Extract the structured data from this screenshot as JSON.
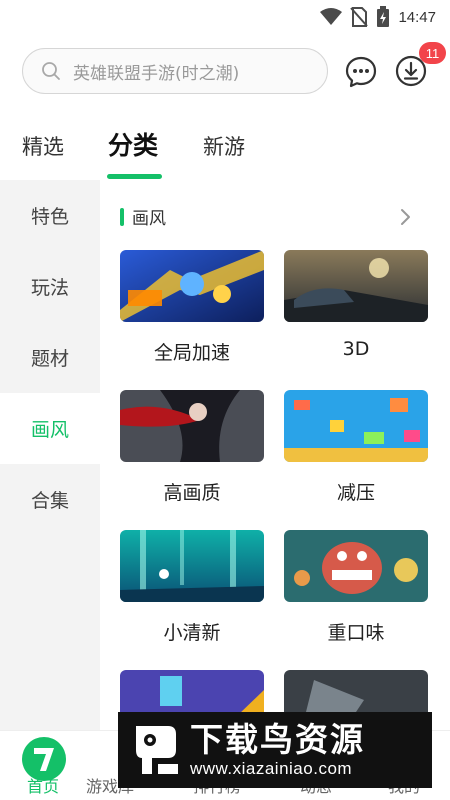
{
  "status_bar": {
    "time": "14:47"
  },
  "header": {
    "search_placeholder": "英雄联盟手游(时之潮)",
    "download_badge": "11"
  },
  "top_tabs": [
    {
      "label": "精选",
      "active": false
    },
    {
      "label": "分类",
      "active": true
    },
    {
      "label": "新游",
      "active": false
    }
  ],
  "sidebar": {
    "items": [
      {
        "label": "特色",
        "active": false
      },
      {
        "label": "玩法",
        "active": false
      },
      {
        "label": "题材",
        "active": false
      },
      {
        "label": "画风",
        "active": true
      },
      {
        "label": "合集",
        "active": false
      }
    ]
  },
  "content": {
    "section_title": "画风",
    "cards": [
      {
        "label": "全局加速"
      },
      {
        "label": "3D"
      },
      {
        "label": "高画质"
      },
      {
        "label": "减压"
      },
      {
        "label": "小清新"
      },
      {
        "label": "重口味"
      },
      {
        "label": ""
      },
      {
        "label": ""
      }
    ]
  },
  "bottom_nav": {
    "items": [
      {
        "label": "首页",
        "active": true
      },
      {
        "label": "游戏库",
        "active": false
      },
      {
        "label": "排行榜",
        "active": false
      },
      {
        "label": "动态",
        "active": false
      },
      {
        "label": "我的",
        "active": false
      }
    ]
  },
  "watermark": {
    "title": "下载鸟资源",
    "url": "www.xiazainiao.com"
  },
  "colors": {
    "accent": "#14c068",
    "badge": "#f2444a"
  }
}
